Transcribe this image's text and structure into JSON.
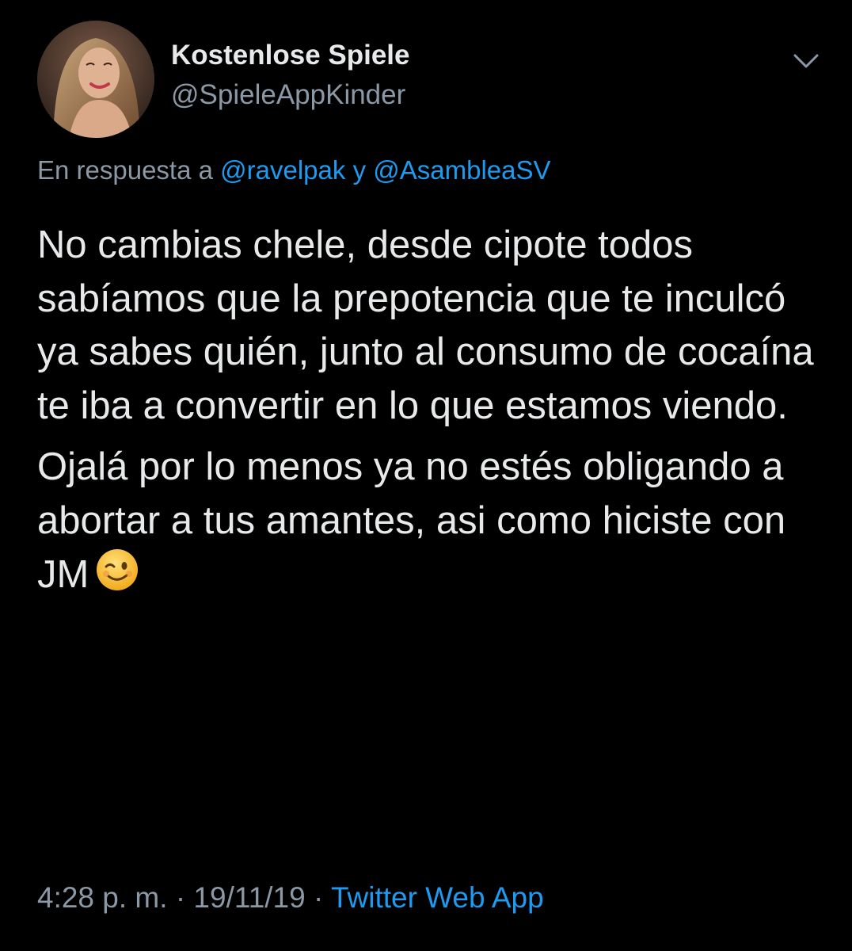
{
  "author": {
    "display_name": "Kostenlose Spiele",
    "handle": "@SpieleAppKinder"
  },
  "reply": {
    "prefix": "En respuesta a",
    "mention_1": "@ravelpak",
    "connector": "y",
    "mention_2": "@AsambleaSV"
  },
  "body": {
    "paragraph_1": "No cambias chele, desde cipote todos sabíamos que la prepotencia que te inculcó ya sabes quién, junto al consumo de cocaína te iba a convertir en lo que estamos viendo.",
    "paragraph_2": "Ojalá por lo menos ya no estés obligando a abortar a tus amantes, asi como hiciste con JM"
  },
  "meta": {
    "time": "4:28 p. m.",
    "separator": "·",
    "date": "19/11/19",
    "source": "Twitter Web App"
  },
  "icons": {
    "menu": "chevron-down-icon",
    "emoji": "winking-face-emoji"
  },
  "colors": {
    "background": "#000000",
    "text": "#e7e9ea",
    "secondary": "#8b98a5",
    "link": "#1d9bf0"
  }
}
